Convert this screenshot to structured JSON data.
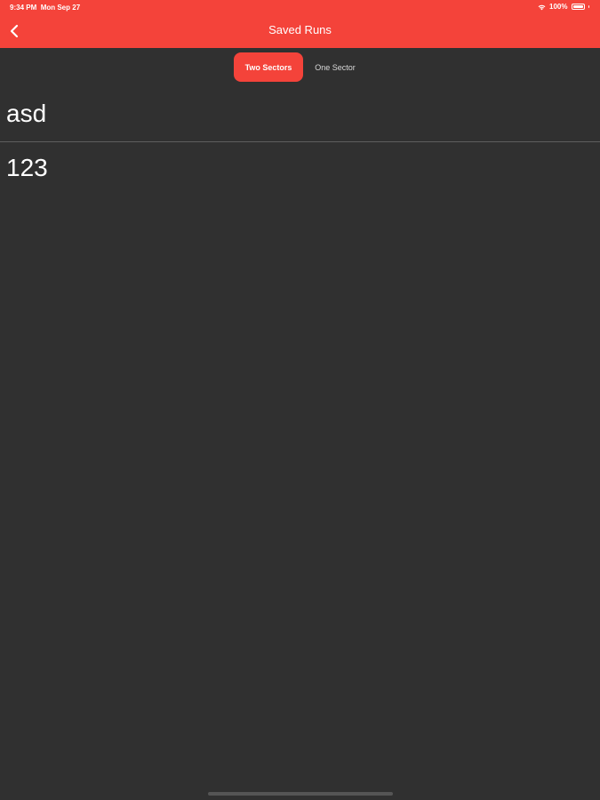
{
  "status_bar": {
    "time": "9:34 PM",
    "date": "Mon Sep 27",
    "battery": "100%"
  },
  "nav": {
    "title": "Saved Runs",
    "back_icon": "chevron-left-icon"
  },
  "segments": {
    "active": "Two Sectors",
    "inactive": "One Sector"
  },
  "runs": [
    {
      "name": "asd"
    },
    {
      "name": "123"
    }
  ],
  "colors": {
    "accent": "#f4433a",
    "background": "#303030",
    "divider": "#5e5e5e"
  }
}
